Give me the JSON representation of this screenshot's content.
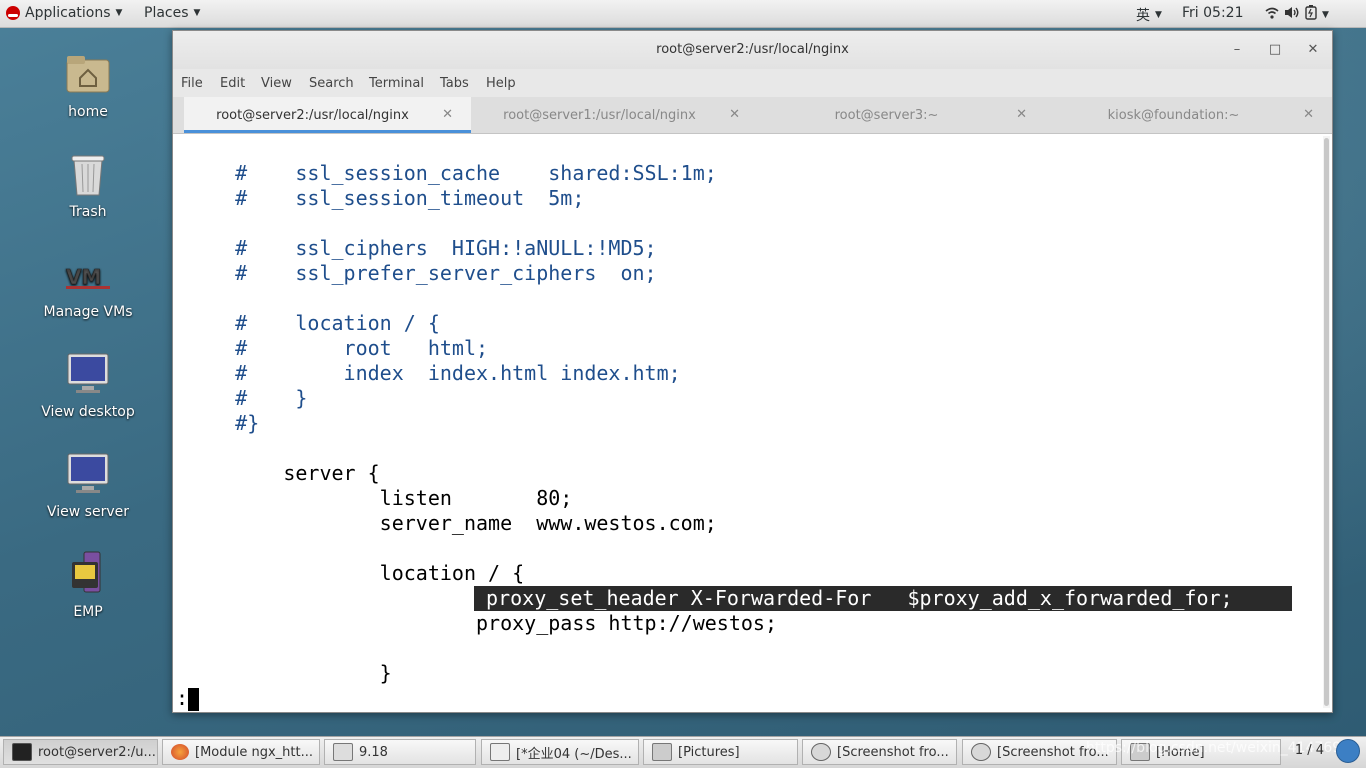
{
  "topbar": {
    "applications": "Applications",
    "places": "Places",
    "input_method": "英",
    "clock": "Fri 05:21"
  },
  "desktop": {
    "icons": [
      {
        "label": "home",
        "icon": "home-folder-icon"
      },
      {
        "label": "Trash",
        "icon": "trash-icon"
      },
      {
        "label": "Manage VMs",
        "icon": "vmm-icon"
      },
      {
        "label": "View desktop",
        "icon": "monitor-icon"
      },
      {
        "label": "View server",
        "icon": "monitor-icon"
      },
      {
        "label": "EMP",
        "icon": "emp-icon"
      }
    ]
  },
  "window": {
    "title": "root@server2:/usr/local/nginx",
    "menu": [
      "File",
      "Edit",
      "View",
      "Search",
      "Terminal",
      "Tabs",
      "Help"
    ],
    "tabs": [
      {
        "label": "root@server2:/usr/local/nginx",
        "active": true
      },
      {
        "label": "root@server1:/usr/local/nginx",
        "active": false
      },
      {
        "label": "root@server3:~",
        "active": false
      },
      {
        "label": "kiosk@foundation:~",
        "active": false
      }
    ],
    "terminal_lines": [
      "    #    ssl_session_cache    shared:SSL:1m;",
      "    #    ssl_session_timeout  5m;",
      "",
      "    #    ssl_ciphers  HIGH:!aNULL:!MD5;",
      "    #    ssl_prefer_server_ciphers  on;",
      "",
      "    #    location / {",
      "    #        root   html;",
      "    #        index  index.html index.htm;",
      "    #    }",
      "    #}",
      "",
      "        server {",
      "                listen       80;",
      "                server_name  www.westos.com;",
      "",
      "                location / {",
      " proxy_set_header X-Forwarded-For   $proxy_add_x_forwarded_for;",
      "                        proxy_pass http://westos;",
      "",
      "                }",
      ":"
    ]
  },
  "taskbar": {
    "items": [
      {
        "label": "root@server2:/u...",
        "icon": "terminal-icon",
        "active": true
      },
      {
        "label": "[Module ngx_htt...",
        "icon": "firefox-icon",
        "active": false
      },
      {
        "label": "9.18",
        "icon": "text-editor-icon",
        "active": false
      },
      {
        "label": "[*企业04 (~/Des...",
        "icon": "gedit-icon",
        "active": false
      },
      {
        "label": "[Pictures]",
        "icon": "file-manager-icon",
        "active": false
      },
      {
        "label": "[Screenshot fro...",
        "icon": "screenshot-icon",
        "active": false
      },
      {
        "label": "[Screenshot fro...",
        "icon": "screenshot-icon",
        "active": false
      },
      {
        "label": "[Home]",
        "icon": "file-manager-icon",
        "active": false
      }
    ],
    "watermark": "https://blog.csdn.net/weixin_41476978",
    "pager": "1 / 4"
  },
  "colors": {
    "comment": "#1f4e8c",
    "highlight_bg": "#2a2a2a",
    "active_tab_accent": "#4a90d9"
  }
}
